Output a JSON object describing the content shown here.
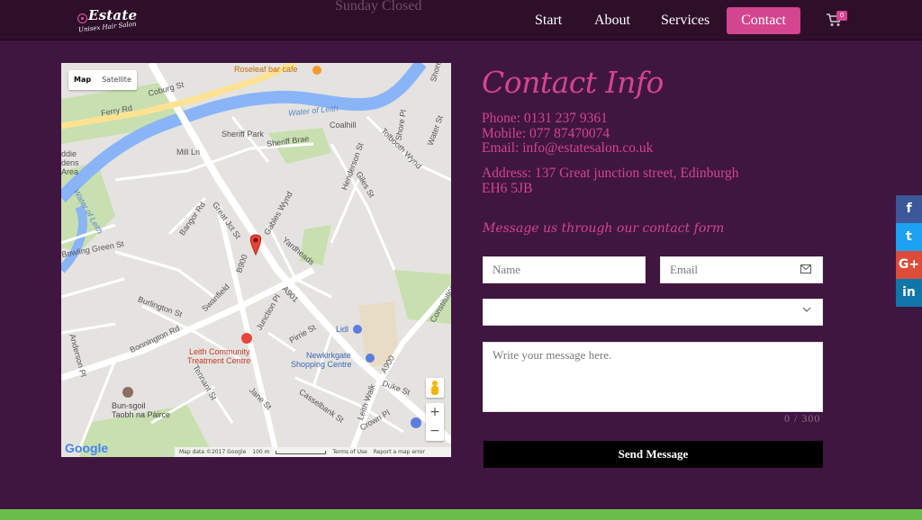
{
  "header": {
    "logo_title": "Estate",
    "logo_subtitle": "Unisex Hair Salon",
    "hours_text": "Sunday Closed",
    "nav": [
      {
        "label": "Start"
      },
      {
        "label": "About"
      },
      {
        "label": "Services"
      },
      {
        "label": "Contact"
      }
    ],
    "cart_count": "0",
    "accent_color": "#d3458e"
  },
  "map": {
    "type_map": "Map",
    "type_satellite": "Satellite",
    "zoom_in": "+",
    "zoom_out": "−",
    "google": "Google",
    "footer_data": "Map data ©2017 Google",
    "footer_scale": "100 m",
    "footer_terms": "Terms of Use",
    "footer_report": "Report a map error",
    "labels": {
      "roseleaf": "Roseleaf bar cafe",
      "ferry_rd": "Ferry Rd",
      "coburg": "Coburg St",
      "water_leith_1": "Water of Leith",
      "water_leith_2": "Water of Leith",
      "sheriff_park": "Sheriff Park",
      "sheriff_brae": "Sheriff Brae",
      "coalhill": "Coalhill",
      "mill_ln": "Mill Ln",
      "great_jct": "Great Jct St",
      "gables_wynd": "Gables Wynd",
      "tolbooth": "Tolbooth Wynd",
      "henderson_st": "Henderson St",
      "giles_st": "Giles St",
      "yardheads": "Yardheads",
      "bangor": "Bangor Rd",
      "b900": "B900",
      "a901": "A901",
      "burlington": "Burlington St",
      "swanfield": "Swanfield",
      "junction_pl": "Junction Pl",
      "pirrie": "Pirrie St",
      "lidl": "Lidl",
      "newkirkgate_1": "Newkirkgate",
      "newkirkgate_2": "Shopping Centre",
      "bonnington": "Bonnington Rd",
      "leith_comm_1": "Leith Community",
      "leith_comm_2": "Treatment Centre",
      "tennant": "Tennant St",
      "jane": "Jane St",
      "casselbank": "Casselbank St",
      "leith_walk": "Leith Walk",
      "crown_pl": "Crown Pl",
      "duke_st": "Duke St",
      "a900": "A900",
      "bun_sgoil_1": "Bun-sgoil",
      "bun_sgoil_2": "Taobh na Pàirce",
      "bowling_green": "Bowling Green St",
      "anderson_pl": "Anderson Pl",
      "shore_pl": "Shore Pl",
      "water_st": "Water St",
      "shore": "Shore",
      "constitution": "Constitution",
      "dens_area": "ddie dens Area"
    }
  },
  "contact": {
    "title": "Contact Info",
    "phone": "Phone: 0131 237 9361",
    "mobile": "Mobile: 077 87470074",
    "email": "Email: info@estatesalon.co.uk",
    "address_line1": "Address: 137 Great junction street, Edinburgh",
    "address_line2": "EH6 5JB",
    "form_heading": "Message us through our contact form"
  },
  "form": {
    "name_placeholder": "Name",
    "email_placeholder": "Email",
    "select_value": "",
    "message_placeholder": "Write your message here.",
    "counter": "0 / 300",
    "send_label": "Send Message"
  },
  "social": {
    "facebook": "f",
    "twitter": "t",
    "google_plus": "G+",
    "linkedin": "in"
  }
}
